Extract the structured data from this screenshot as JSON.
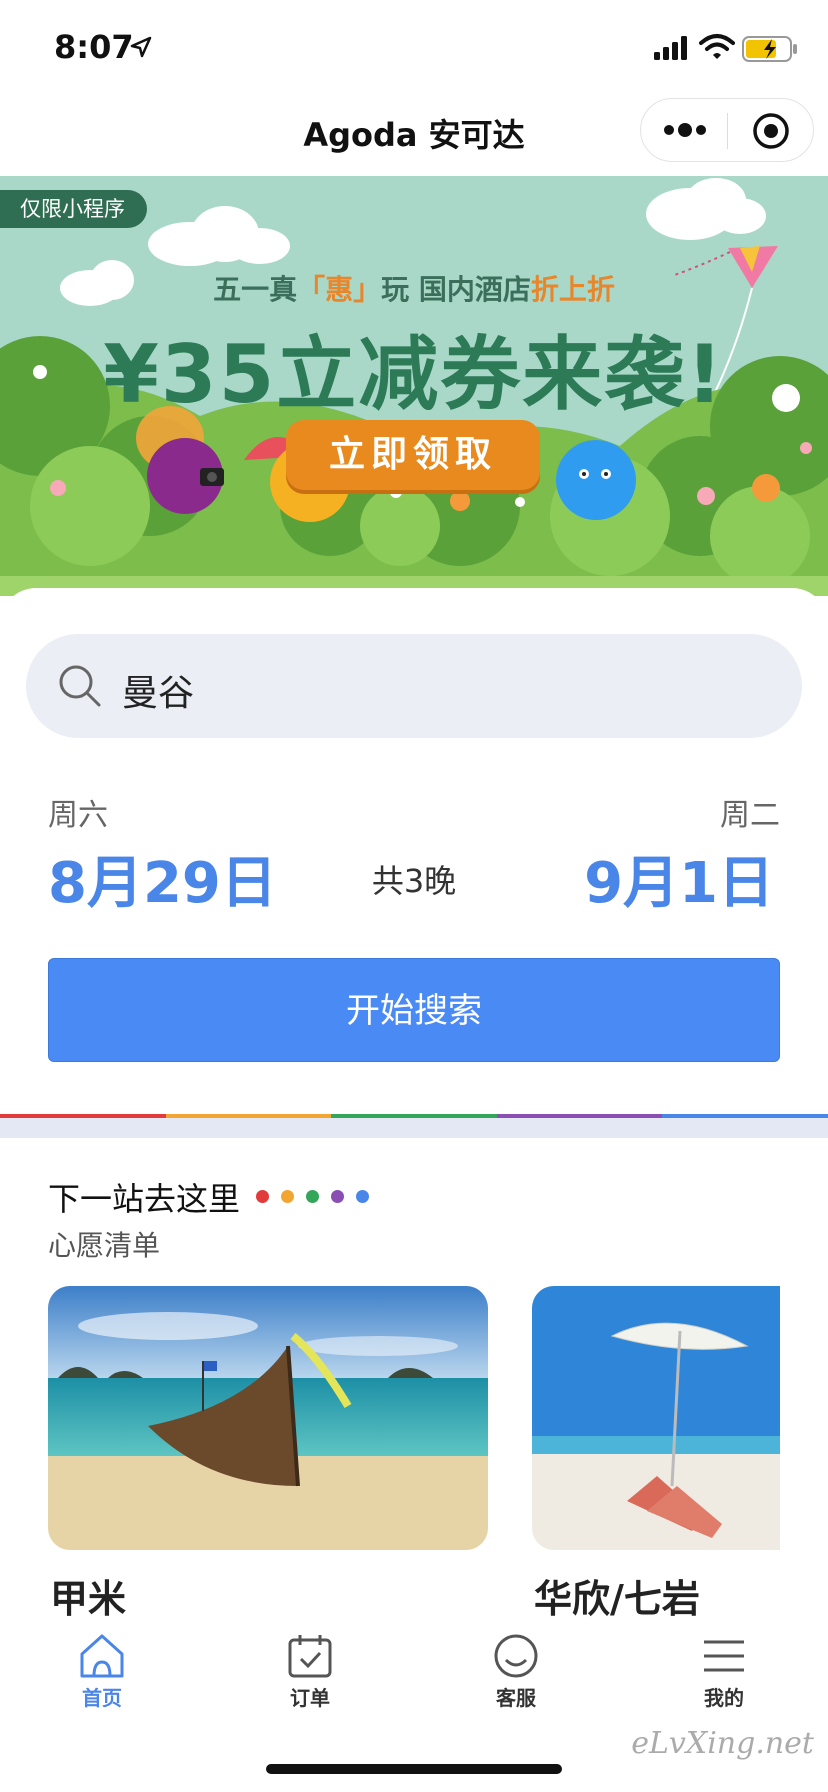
{
  "status_bar": {
    "time": "8:07",
    "location_icon": "location-arrow-icon",
    "signal_icon": "cellular-signal-icon",
    "wifi_icon": "wifi-icon",
    "battery_icon": "battery-charging-icon"
  },
  "nav": {
    "title": "Agoda 安可达",
    "more_icon": "more-dots-icon",
    "close_icon": "miniprogram-close-icon"
  },
  "banner": {
    "badge": "仅限小程序",
    "subtitle_parts": [
      "五一真",
      "「惠」",
      "玩 国内酒店",
      "折上折"
    ],
    "title": "¥35立减券来袭!",
    "cta": "立即领取"
  },
  "search": {
    "icon": "search-icon",
    "query": "曼谷",
    "checkin_weekday": "周六",
    "checkin_date": "8月29日",
    "nights": "共3晚",
    "checkout_weekday": "周二",
    "checkout_date": "9月1日",
    "button": "开始搜索"
  },
  "colors": {
    "accent_blue": "#4a86e8",
    "rainbow": [
      "#e23b3b",
      "#f2a531",
      "#33a65a",
      "#8b4fb3",
      "#4a86e8"
    ]
  },
  "destinations": {
    "heading": "下一站去这里",
    "subheading": "心愿清单",
    "cards": [
      {
        "name": "甲米",
        "image": "longtail-boat-beach-photo"
      },
      {
        "name": "华欣/七岩",
        "image": "beach-umbrella-photo"
      }
    ]
  },
  "tab_bar": {
    "items": [
      {
        "label": "首页",
        "icon": "home-icon",
        "active": true
      },
      {
        "label": "订单",
        "icon": "calendar-check-icon",
        "active": false
      },
      {
        "label": "客服",
        "icon": "smile-face-icon",
        "active": false
      },
      {
        "label": "我的",
        "icon": "menu-lines-icon",
        "active": false
      }
    ]
  },
  "watermark": "eLvXing.net"
}
